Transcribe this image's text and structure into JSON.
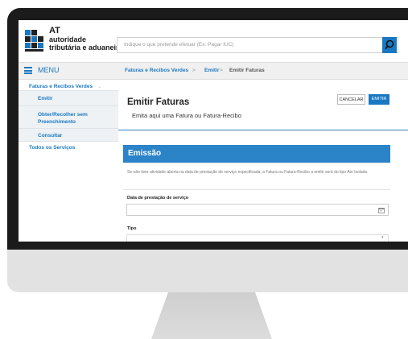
{
  "header": {
    "logo_line1": "AT",
    "logo_line2": "autoridade",
    "logo_line3": "tributária e aduaneira",
    "search_placeholder": "Indique o que pretende efetuar (Ex: Pagar IUC)"
  },
  "sidebar": {
    "menu_label": "MENU",
    "items": [
      {
        "label": "Faturas e Recibos Verdes"
      },
      {
        "label": "Emitir"
      },
      {
        "label": "Obter/Recolher sem Preenchimento"
      },
      {
        "label": "Consultar"
      },
      {
        "label": "Todos os Serviços"
      }
    ]
  },
  "breadcrumb": {
    "items": [
      "Faturas e Recibos Verdes",
      "Emitir",
      "Emitir Faturas"
    ],
    "separator": ">"
  },
  "page": {
    "title": "Emitir Faturas",
    "subtitle": "Emita aqui uma Fatura ou Fatura-Recibo",
    "cancel_label": "CANCELAR",
    "emit_label": "EMITIR"
  },
  "section": {
    "title": "Emissão",
    "info": "Se não tiver atividade aberta na data de prestação de serviço especificada, a Fatura ou Fatura-Recibo a emitir será do tipo Ato Isolado.",
    "date_label": "Data de prestação de serviço",
    "type_label": "Tipo"
  },
  "colors": {
    "accent": "#1a78c2",
    "section_header": "#2b83c8"
  }
}
